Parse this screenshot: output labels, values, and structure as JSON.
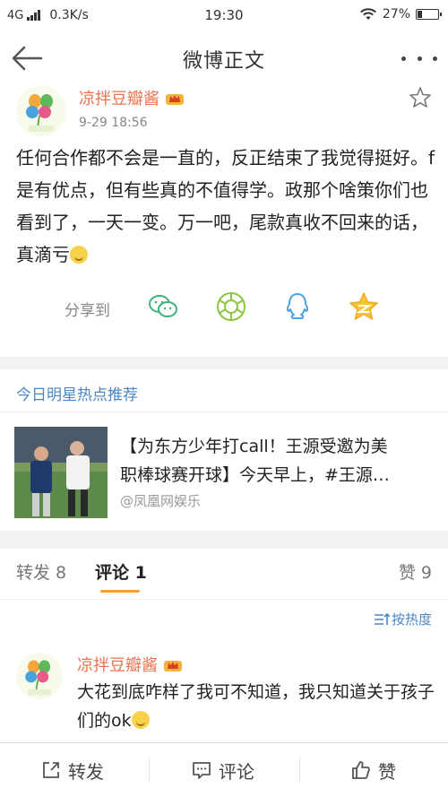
{
  "status_bar": {
    "network": "4G",
    "speed": "0.3K/s",
    "time": "19:30",
    "battery": "27%",
    "battery_level": 0.27
  },
  "nav": {
    "title": "微博正文"
  },
  "post": {
    "author": "凉拌豆瓣酱",
    "time": "9-29 18:56",
    "text": "任何合作都不会是一直的，反正结束了我觉得挺好。f是有优点，但有些真的不值得学。政那个啥策你们也看到了，一天一变。万一吧，尾款真收不回来的话，真滴亏"
  },
  "share": {
    "label": "分享到",
    "targets": [
      "wechat-icon",
      "moments-icon",
      "qq-icon",
      "qzone-icon"
    ]
  },
  "recommend": {
    "section_title": "今日明星热点推荐",
    "headline_line1": "【为东方少年打call！王源受邀为美",
    "headline_line2": "职棒球赛开球】今天早上，#王源…",
    "source": "@凤凰网娱乐"
  },
  "tabs": {
    "repost": "转发 8",
    "comment": "评论 1",
    "like": "赞 9"
  },
  "sort": {
    "label": "按热度"
  },
  "comment": {
    "author": "凉拌豆瓣酱",
    "text": "大花到底咋样了我可不知道，我只知道关于孩子们的ok"
  },
  "bottom_bar": {
    "repost": "转发",
    "comment": "评论",
    "like": "赞"
  },
  "colors": {
    "accent_name": "#eb7350",
    "link_blue": "#4a86c5",
    "tab_underline": "#f7a032"
  }
}
